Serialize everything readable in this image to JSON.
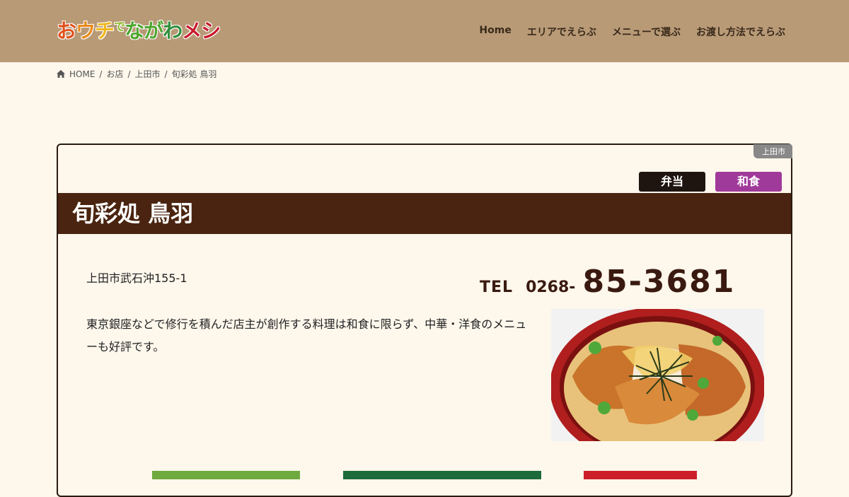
{
  "header": {
    "logo_parts": [
      "お",
      "ウ",
      "チ",
      "で",
      "な",
      "が",
      "わ",
      "メシ"
    ],
    "nav": [
      "Home",
      "エリアでえらぶ",
      "メニューで選ぶ",
      "お渡し方法でえらぶ"
    ]
  },
  "breadcrumb": {
    "home": "HOME",
    "items": [
      "お店",
      "上田市",
      "旬彩処 鳥羽"
    ],
    "sep": "/"
  },
  "shop": {
    "area_badge": "上田市",
    "tags": [
      "弁当",
      "和食"
    ],
    "name": "旬彩処 鳥羽",
    "address": "上田市武石沖155-1",
    "tel_label": "TEL",
    "tel_prefix": "0268-",
    "tel_number": "85-3681",
    "description": "東京銀座などで修行を積んだ店主が創作する料理は和食に限らず、中華・洋食のメニューも好評です。"
  },
  "colors": {
    "header_bg": "#b89a77",
    "title_bar": "#4a2410",
    "tag_bento": "#1e1410",
    "tag_washoku": "#a03a9a"
  }
}
